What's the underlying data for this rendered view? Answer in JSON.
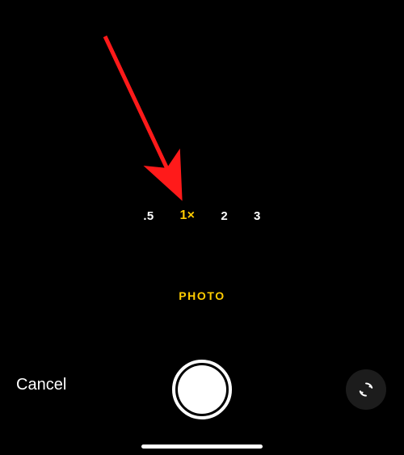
{
  "annotation": {
    "arrow_color": "#ff1a1a"
  },
  "camera": {
    "zoom": {
      "options": {
        "0": ".5",
        "1": "1×",
        "2": "2",
        "3": "3"
      },
      "selected_index": 1
    },
    "mode_label": "PHOTO",
    "cancel_label": "Cancel",
    "colors": {
      "accent": "#ffcc00"
    }
  }
}
